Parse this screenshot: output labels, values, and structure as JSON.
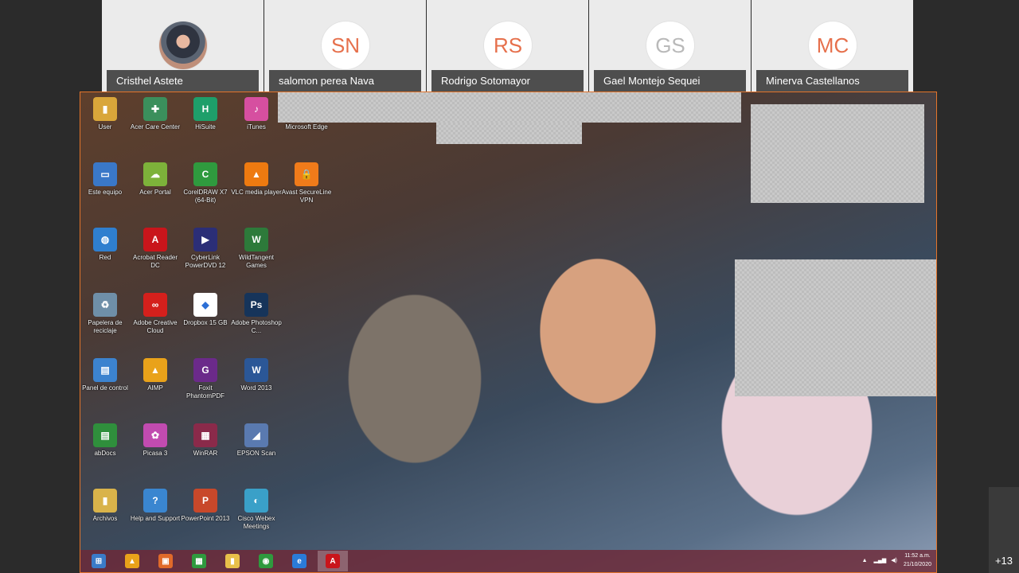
{
  "participants": [
    {
      "name": "Cristhel Astete",
      "initials": "",
      "avatar": "photo"
    },
    {
      "name": "salomon perea Nava",
      "initials": "SN",
      "avatar": "initials-orange"
    },
    {
      "name": "Rodrigo Sotomayor",
      "initials": "RS",
      "avatar": "initials-orange"
    },
    {
      "name": "Gael Montejo Sequei",
      "initials": "GS",
      "avatar": "initials-gray"
    },
    {
      "name": "Minerva Castellanos",
      "initials": "MC",
      "avatar": "initials-orange"
    }
  ],
  "more_participants": "+13",
  "shared_screen": {
    "desktop_icons": [
      {
        "label": "User",
        "icon": "folder-icon",
        "color": "#d9a63a",
        "glyph": "▮"
      },
      {
        "label": "Acer Care Center",
        "icon": "acer-care-icon",
        "color": "#3b8f5c",
        "glyph": "✚"
      },
      {
        "label": "HiSuite",
        "icon": "hisuite-icon",
        "color": "#1e9f6a",
        "glyph": "H"
      },
      {
        "label": "iTunes",
        "icon": "itunes-icon",
        "color": "#d64fa0",
        "glyph": "♪"
      },
      {
        "label": "Microsoft Edge",
        "icon": "edge-icon",
        "color": "#2a7bd8",
        "glyph": "e"
      },
      {
        "label": "Este equipo",
        "icon": "computer-icon",
        "color": "#3a78c8",
        "glyph": "▭"
      },
      {
        "label": "Acer Portal",
        "icon": "acer-portal-icon",
        "color": "#7db23a",
        "glyph": "☁"
      },
      {
        "label": "CorelDRAW X7 (64-Bit)",
        "icon": "coreldraw-icon",
        "color": "#2f9a3e",
        "glyph": "C"
      },
      {
        "label": "VLC media player",
        "icon": "vlc-icon",
        "color": "#ee7a10",
        "glyph": "▲"
      },
      {
        "label": "Avast SecureLine VPN",
        "icon": "avast-vpn-icon",
        "color": "#f07b1a",
        "glyph": "🔒"
      },
      {
        "label": "Red",
        "icon": "network-icon",
        "color": "#2f7fcf",
        "glyph": "◍"
      },
      {
        "label": "Acrobat Reader DC",
        "icon": "acrobat-icon",
        "color": "#c9151b",
        "glyph": "A"
      },
      {
        "label": "CyberLink PowerDVD 12",
        "icon": "powerdvd-icon",
        "color": "#2b2e77",
        "glyph": "▶"
      },
      {
        "label": "WildTangent Games",
        "icon": "wildtangent-icon",
        "color": "#2d7a3a",
        "glyph": "W"
      },
      {
        "label": "Papelera de reciclaje",
        "icon": "recycle-bin-icon",
        "color": "#6f8fa8",
        "glyph": "♻"
      },
      {
        "label": "Adobe Creative Cloud",
        "icon": "creative-cloud-icon",
        "color": "#d4201c",
        "glyph": "∞"
      },
      {
        "label": "Dropbox 15 GB",
        "icon": "dropbox-icon",
        "color": "#ffffff",
        "glyph": "◆"
      },
      {
        "label": "Adobe Photoshop C...",
        "icon": "photoshop-icon",
        "color": "#16345a",
        "glyph": "Ps"
      },
      {
        "label": "Panel de control",
        "icon": "control-panel-icon",
        "color": "#3c83cf",
        "glyph": "▤"
      },
      {
        "label": "AIMP",
        "icon": "aimp-icon",
        "color": "#e9a21a",
        "glyph": "▲"
      },
      {
        "label": "Foxit PhantomPDF",
        "icon": "foxit-icon",
        "color": "#6b2a8a",
        "glyph": "G"
      },
      {
        "label": "Word 2013",
        "icon": "word-icon",
        "color": "#2b5797",
        "glyph": "W"
      },
      {
        "label": "abDocs",
        "icon": "abdocs-icon",
        "color": "#2f8f3c",
        "glyph": "▤"
      },
      {
        "label": "Picasa 3",
        "icon": "picasa-icon",
        "color": "#c14bb0",
        "glyph": "✿"
      },
      {
        "label": "WinRAR",
        "icon": "winrar-icon",
        "color": "#8a2a4a",
        "glyph": "▦"
      },
      {
        "label": "EPSON Scan",
        "icon": "epson-scan-icon",
        "color": "#5a7ab0",
        "glyph": "◢"
      },
      {
        "label": "Archivos",
        "icon": "folder-icon",
        "color": "#d9b34a",
        "glyph": "▮"
      },
      {
        "label": "Help and Support",
        "icon": "help-icon",
        "color": "#3a86d0",
        "glyph": "?"
      },
      {
        "label": "PowerPoint 2013",
        "icon": "powerpoint-icon",
        "color": "#c8482a",
        "glyph": "P"
      },
      {
        "label": "Cisco Webex Meetings",
        "icon": "webex-icon",
        "color": "#3aa0c8",
        "glyph": "◐"
      }
    ],
    "taskbar": [
      {
        "name": "start",
        "icon": "windows-start-icon",
        "color": "#3a7bc8",
        "glyph": "⊞"
      },
      {
        "name": "aimp",
        "icon": "aimp-icon",
        "color": "#e9a21a",
        "glyph": "▲"
      },
      {
        "name": "media",
        "icon": "media-icon",
        "color": "#e06a2a",
        "glyph": "▣"
      },
      {
        "name": "store",
        "icon": "store-icon",
        "color": "#2f9a3e",
        "glyph": "▦"
      },
      {
        "name": "explorer",
        "icon": "file-explorer-icon",
        "color": "#e8c04a",
        "glyph": "▮"
      },
      {
        "name": "chrome",
        "icon": "chrome-icon",
        "color": "#2f9a3e",
        "glyph": "◉"
      },
      {
        "name": "edge",
        "icon": "edge-icon",
        "color": "#2a7bd8",
        "glyph": "e"
      },
      {
        "name": "acrobat",
        "icon": "acrobat-icon",
        "color": "#c9151b",
        "glyph": "A"
      }
    ],
    "clock": {
      "time": "11:52 a.m.",
      "date": "21/10/2020"
    }
  }
}
